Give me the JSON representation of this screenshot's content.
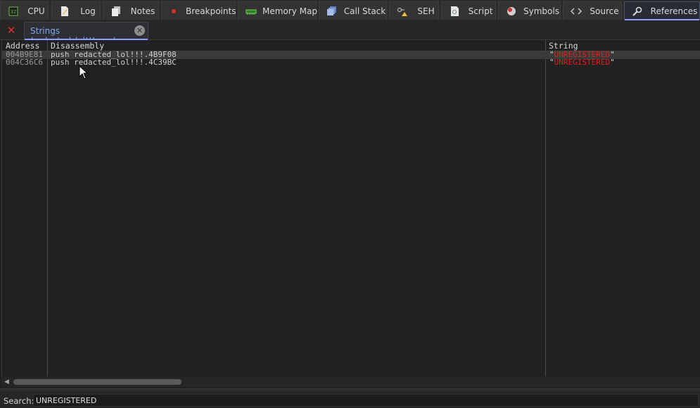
{
  "tabs": [
    {
      "label": "CPU",
      "icon": "cpu-icon"
    },
    {
      "label": "Log",
      "icon": "log-icon"
    },
    {
      "label": "Notes",
      "icon": "notes-icon"
    },
    {
      "label": "Breakpoints",
      "icon": "breakpoint-icon"
    },
    {
      "label": "Memory Map",
      "icon": "memory-map-icon"
    },
    {
      "label": "Call Stack",
      "icon": "call-stack-icon"
    },
    {
      "label": "SEH",
      "icon": "seh-icon"
    },
    {
      "label": "Script",
      "icon": "script-icon"
    },
    {
      "label": "Symbols",
      "icon": "symbols-icon"
    },
    {
      "label": "Source",
      "icon": "source-icon"
    },
    {
      "label": "References",
      "icon": "references-icon",
      "active": true
    }
  ],
  "doc_tab": {
    "label": "Strings (redacted_lol!!!.exe)"
  },
  "grid": {
    "columns": [
      "Address",
      "Disassembly",
      "String"
    ],
    "rows": [
      {
        "address": "004B9E81",
        "disassembly": "push redacted_lol!!!.4B9F08",
        "string_quote_open": "\"",
        "string": "UNREGISTERED",
        "string_quote_close": "\""
      },
      {
        "address": "004C36C6",
        "disassembly": "push redacted_lol!!!.4C39BC",
        "string_quote_open": "\"",
        "string": "UNREGISTERED",
        "string_quote_close": "\""
      }
    ]
  },
  "search": {
    "label": "Search:",
    "value": "UNREGISTERED"
  },
  "colors": {
    "accent": "#8ea0ff",
    "string_red": "#e02121",
    "close_red": "#e0322d"
  }
}
